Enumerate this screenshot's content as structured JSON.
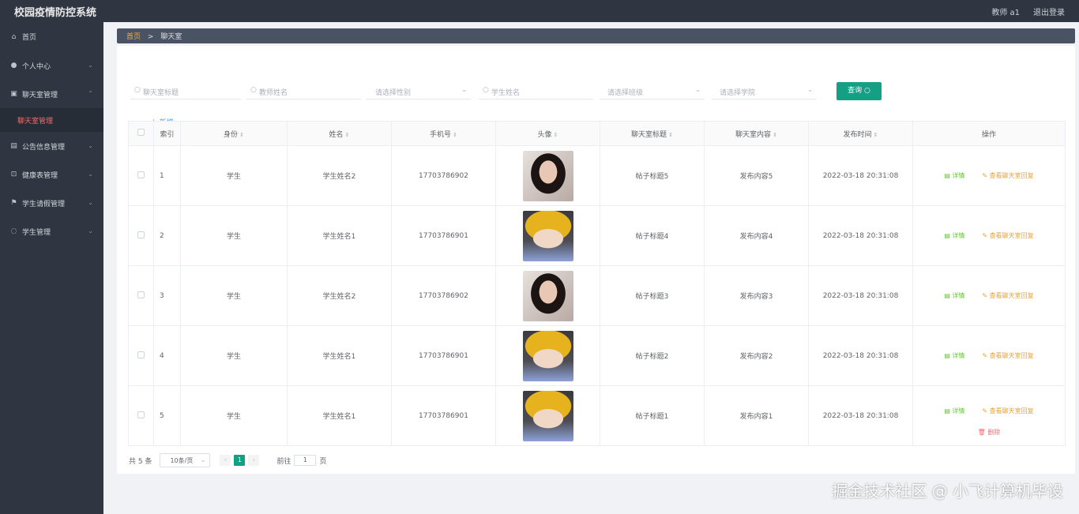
{
  "app": {
    "title": "校园疫情防控系统",
    "user": "教师 a1",
    "logout": "退出登录"
  },
  "sidebar": {
    "items": [
      {
        "label": "首页"
      },
      {
        "label": "个人中心"
      },
      {
        "label": "聊天室管理"
      },
      {
        "label": "公告信息管理"
      },
      {
        "label": "健康表管理"
      },
      {
        "label": "学生请假管理"
      },
      {
        "label": "学生管理"
      }
    ],
    "active_sub": "聊天室管理"
  },
  "breadcrumb": {
    "home": "首页",
    "sep": ">",
    "current": "聊天室"
  },
  "search": {
    "chat_title": "聊天室标题",
    "teacher_name": "教师姓名",
    "gender": "请选择性别",
    "student_name": "学生姓名",
    "class": "请选择班级",
    "college": "请选择学院",
    "query_button": "查询",
    "add_button": "新增"
  },
  "table": {
    "headers": [
      "索引",
      "身份",
      "姓名",
      "手机号",
      "头像",
      "聊天室标题",
      "聊天室内容",
      "发布时间",
      "操作"
    ],
    "rows": [
      {
        "idx": "1",
        "role": "学生",
        "name": "学生姓名2",
        "phone": "17703786902",
        "avatar": "girl",
        "title": "帖子标题5",
        "content": "发布内容5",
        "time": "2022-03-18 20:31:08"
      },
      {
        "idx": "2",
        "role": "学生",
        "name": "学生姓名1",
        "phone": "17703786901",
        "avatar": "boy",
        "title": "帖子标题4",
        "content": "发布内容4",
        "time": "2022-03-18 20:31:08"
      },
      {
        "idx": "3",
        "role": "学生",
        "name": "学生姓名2",
        "phone": "17703786902",
        "avatar": "girl",
        "title": "帖子标题3",
        "content": "发布内容3",
        "time": "2022-03-18 20:31:08"
      },
      {
        "idx": "4",
        "role": "学生",
        "name": "学生姓名1",
        "phone": "17703786901",
        "avatar": "boy",
        "title": "帖子标题2",
        "content": "发布内容2",
        "time": "2022-03-18 20:31:08"
      },
      {
        "idx": "5",
        "role": "学生",
        "name": "学生姓名1",
        "phone": "17703786901",
        "avatar": "boy",
        "title": "帖子标题1",
        "content": "发布内容1",
        "time": "2022-03-18 20:31:08"
      }
    ],
    "op_detail": "详情",
    "op_reply": "查看聊天室回复",
    "op_delete": "删除"
  },
  "pager": {
    "total": "共 5 条",
    "page_size": "10条/页",
    "current_page": "1",
    "goto_label": "前往",
    "goto_value": "1",
    "page_suffix": "页"
  },
  "watermark": "掘金技术社区 @ 小飞计算机毕设"
}
